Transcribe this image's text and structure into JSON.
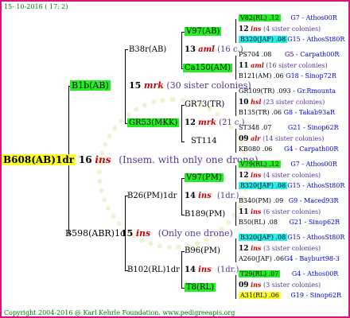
{
  "header": {
    "date": "15- 10-2016 ( 17: 2)"
  },
  "footer": {
    "copyright": "Copyright 2004-2016 @ Karl Kehrle Foundation.   www.pedigreeapis.org"
  },
  "root": {
    "label": "B608(AB)1dr",
    "num": "16",
    "ins": "ins",
    "note": "(Insem. with only one drone)"
  },
  "gen1": [
    {
      "label": "B1b(AB)",
      "num": "15",
      "mark": "mrk",
      "note": "(30 sister colonies)"
    },
    {
      "label": "B598(ABR)1c",
      "num": "15",
      "mark": "ins",
      "note": "(Only one drone)"
    }
  ],
  "gen2": [
    {
      "label": "B38r(AB)",
      "num": "13",
      "mark": "aml",
      "note": "(16 c.)"
    },
    {
      "label": "GR53(MKK)",
      "num": "12",
      "mark": "mrk",
      "note": "(21 c.)"
    },
    {
      "label": "B26(PM)1dr",
      "num": "14",
      "mark": "ins",
      "note": "(1dr.)"
    },
    {
      "label": "B102(RL)1dr",
      "num": "14",
      "mark": "ins",
      "note": "(1dr.)"
    }
  ],
  "gen3": [
    {
      "label": "V97(AB)"
    },
    {
      "label": "Ca150(AM)"
    },
    {
      "label": "GR73(TR)"
    },
    {
      "label": "ST114"
    },
    {
      "label": "V97(PM)"
    },
    {
      "label": "B189(PM)"
    },
    {
      "label": "B96(PM)"
    },
    {
      "label": "T8(RL)"
    }
  ],
  "gen4": [
    {
      "top": "V82(RL) .12",
      "top_right": "G7 - Athos00R",
      "num": "12",
      "mark": "ins",
      "note": "(4 sister colonies)",
      "bottom": "B320(JAF) .08",
      "bottom_right": "G15 - AthosSt80R"
    },
    {
      "top": "PS704 .08",
      "top_right": "G5 - Carpath00R",
      "num": "11",
      "mark": "aml",
      "note": "(16 sister colonies)",
      "bottom": "B121(AM) .06",
      "bottom_right": "G18 - Sinop72R"
    },
    {
      "top": "GR109(TR) .093",
      "top_right": "- Gr.Rmounta",
      "num": "10",
      "mark": "hsl",
      "note": "(23 sister colonies)",
      "bottom": "B135(TR) .06",
      "bottom_right": "G8 - Takab93aR"
    },
    {
      "top": "ST348 .07",
      "top_right": "G21 - Sinop62R",
      "num": "09",
      "mark": "alr",
      "note": "(14 sister colonies)",
      "bottom": "KB080 .06",
      "bottom_right": "G4 - Carpath00R"
    },
    {
      "top": "V79(RL) .12",
      "top_right": "G7 - Athos00R",
      "num": "12",
      "mark": "ins",
      "note": "(4 sister colonies)",
      "bottom": "B320(JAF) .08",
      "bottom_right": "G15 - AthosSt80R"
    },
    {
      "top": "B340(PM) .09",
      "top_right": "G9 - Maced93R",
      "num": "11",
      "mark": "ins",
      "note": "(6 sister colonies)",
      "bottom": "B50(RL) .08",
      "bottom_right": "G21 - Sinop62R"
    },
    {
      "top": "B320(JAF) .08",
      "top_right": "G15 - AthosSt80R",
      "num": "12",
      "mark": "ins",
      "note": "(3 sister colonies)",
      "bottom": "A260(JAF) .06",
      "bottom_right": "G4 - Bayburt98-3"
    },
    {
      "top": "T29(RL) .07",
      "top_right": "G4 - Athos00R",
      "num": "09",
      "mark": "ins",
      "note": "(3 sister colonies)",
      "bottom": "A31(RL) .06",
      "bottom_right": "G19 - Sinop62R"
    }
  ]
}
